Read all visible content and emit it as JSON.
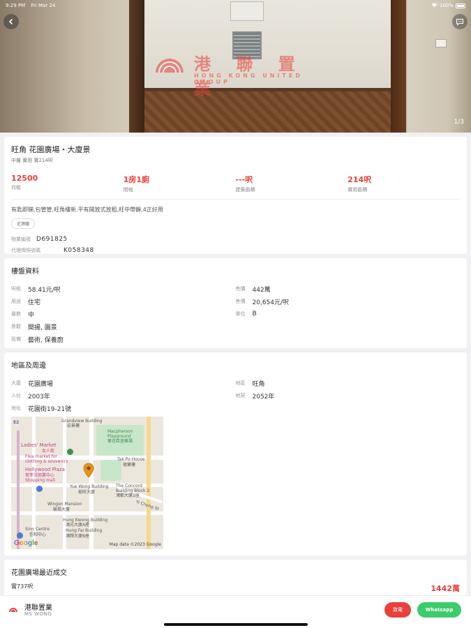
{
  "status_bar": {
    "time": "9:29 PM",
    "date": "Fri Mar 24",
    "battery": "100%"
  },
  "hero": {
    "watermark_cn": "港 聯 置 業",
    "watermark_en": "HONG KONG UNITED GROUP",
    "photo_counter": "1/3"
  },
  "listing": {
    "title": "旺角 花園廣場・大廈景",
    "subtitle": "中層 實用 實214呎",
    "stats": [
      {
        "value": "12500",
        "label": "月租"
      },
      {
        "value": "1房1廁",
        "label": "間格"
      },
      {
        "value": "---呎",
        "label": "建築面積"
      },
      {
        "value": "214呎",
        "label": "實用面積"
      }
    ],
    "description": "有匙即睇,包管管,旺角樓新,平有開放式放租,旺中帶靜,4正好用",
    "tag": "近港鐵",
    "ref_label": "物業編號",
    "ref_value": "D691825",
    "license_label": "代理牌照號碼",
    "license_value": "K058348"
  },
  "unit_info": {
    "title": "樓盤資料",
    "left": [
      {
        "k": "呎租",
        "v": "58.41元/呎"
      },
      {
        "k": "用途",
        "v": "住宅"
      },
      {
        "k": "層數",
        "v": "中"
      },
      {
        "k": "景觀",
        "v": "開揚, 園景"
      },
      {
        "k": "設備",
        "v": "藝術, 保養廚"
      }
    ],
    "right": [
      {
        "k": "售價",
        "v": "442萬"
      },
      {
        "k": "售價",
        "v": "20,654元/呎"
      },
      {
        "k": "單位",
        "v": "B"
      }
    ]
  },
  "area_info": {
    "title": "地區及周邊",
    "left": [
      {
        "k": "大廈",
        "v": "花園廣場"
      },
      {
        "k": "入伙",
        "v": "2003年"
      },
      {
        "k": "地址",
        "v": "花園街19-21號"
      }
    ],
    "right": [
      {
        "k": "地區",
        "v": "旺角"
      },
      {
        "k": "地契",
        "v": "2052年"
      }
    ]
  },
  "map": {
    "labels": {
      "e2": "E2",
      "grandview": "Grandview Building",
      "grandview_cn": "宏景樓",
      "macpherson": "Macpherson",
      "playground": "Playground",
      "playground_cn": "麥花臣遊樂場",
      "ladies": "Ladies' Market",
      "ladies_cn": "女人街",
      "ladies_sub1": "Flea market for",
      "ladies_sub2": "clothing & souvenirs",
      "ladies_sub3": "Shopping mall",
      "hollywood": "Hollywood Plaza",
      "hollywood_cn": "荷李活商業中心",
      "taipo": "Tak Po House",
      "taipo_cn": "德寶樓",
      "yuewong": "Yue Wong Building",
      "yuewong_cn": "裕旺大廈",
      "concord": "The Concord",
      "concord2": "Building Block 2",
      "concord_cn": "鴻都大廈2座",
      "wingon": "Wingon Mansion",
      "wingon_cn": "榮昌大廈",
      "yichong": "Yi Chong St",
      "hungkwong": "Hung Kwong Building",
      "hungkwong_cn": "鴻光大廈A座",
      "hungfai": "Hung Fai Building",
      "hungfai_cn": "鴻輝大廈B座",
      "sino": "Sino Centre",
      "sino_cn": "信和中心",
      "google": "Google",
      "map_data": "Map data ©2023 Google"
    }
  },
  "recent": {
    "title": "花園廣場最近成交",
    "left_text": "實737呎",
    "price": "1442萬"
  },
  "agent": {
    "name": "港聯置業",
    "sub": "MS WONG",
    "call_label": "致電",
    "whatsapp_label": "Whatsapp"
  },
  "colors": {
    "accent": "#e8413b",
    "whatsapp": "#3dcc6a"
  }
}
